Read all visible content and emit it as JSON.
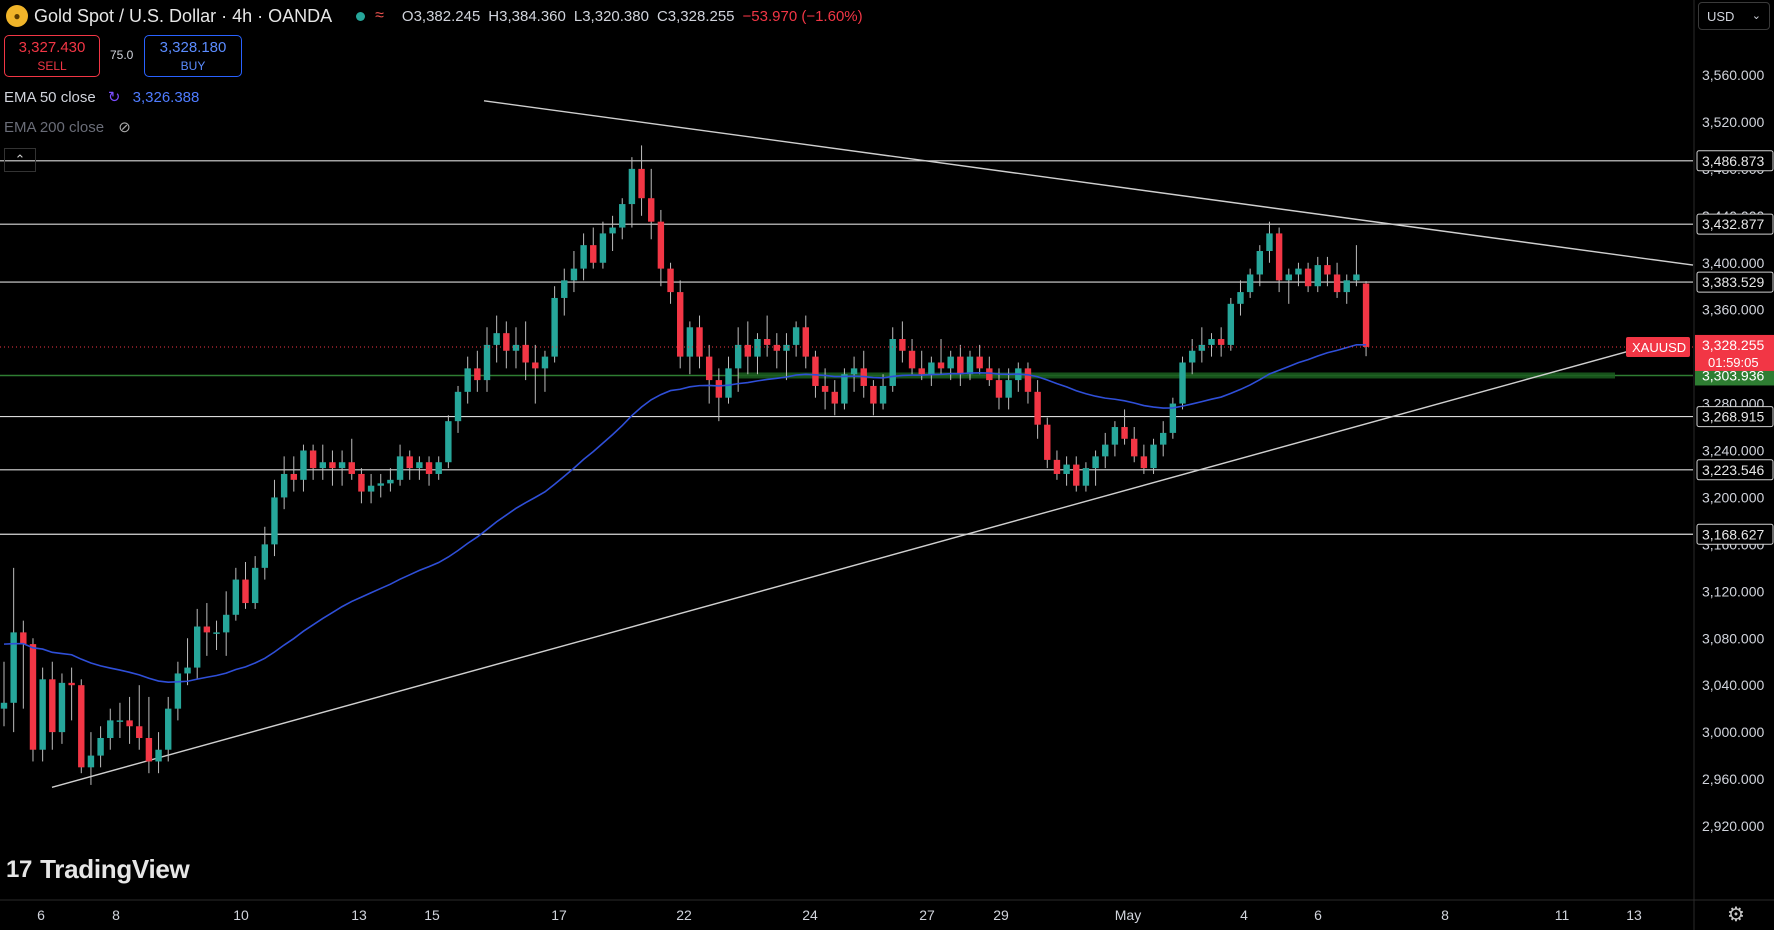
{
  "header": {
    "symbol": "Gold Spot / U.S. Dollar · 4h · OANDA",
    "open_label": "O",
    "open": "3,382.245",
    "high_label": "H",
    "high": "3,384.360",
    "low_label": "L",
    "low": "3,320.380",
    "close_label": "C",
    "close": "3,328.255",
    "change": "−53.970 (−1.60%)"
  },
  "trade": {
    "sell_price": "3,327.430",
    "sell_label": "SELL",
    "spread": "75.0",
    "buy_price": "3,328.180",
    "buy_label": "BUY"
  },
  "indicators": {
    "ema50_label": "EMA 50 close",
    "ema50_value": "3,326.388",
    "ema200_label": "EMA 200 close"
  },
  "currency": "USD",
  "brand": "TradingView",
  "colors": {
    "up": "#26a69a",
    "down": "#f23645",
    "ema": "#2f4fd8",
    "level": "#d9d9d9",
    "support": "#2e7d32",
    "background": "#000000"
  },
  "chart_data": {
    "type": "candlestick",
    "ylim": [
      2900,
      3600
    ],
    "y_ticks": [
      "3,560.000",
      "3,520.000",
      "3,480.000",
      "3,440.000",
      "3,400.000",
      "3,360.000",
      "3,320.000",
      "3,280.000",
      "3,240.000",
      "3,200.000",
      "3,160.000",
      "3,120.000",
      "3,080.000",
      "3,040.000",
      "3,000.000",
      "2,960.000",
      "2,920.000"
    ],
    "x_ticks": [
      "6",
      "8",
      "10",
      "13",
      "15",
      "17",
      "22",
      "24",
      "27",
      "29",
      "May",
      "4",
      "6",
      "8",
      "11",
      "13"
    ],
    "levels": [
      {
        "price": 3486.873,
        "label": "3,486.873"
      },
      {
        "price": 3432.877,
        "label": "3,432.877"
      },
      {
        "price": 3383.529,
        "label": "3,383.529"
      },
      {
        "price": 3268.915,
        "label": "3,268.915"
      },
      {
        "price": 3223.546,
        "label": "3,223.546"
      },
      {
        "price": 3168.627,
        "label": "3,168.627"
      }
    ],
    "support_zone": {
      "price": 3303.936,
      "label": "3,303.936"
    },
    "current": {
      "symbol": "XAUUSD",
      "price": 3328.255,
      "label": "3,328.255",
      "countdown": "01:59:05"
    },
    "ohlc": [
      [
        3020,
        3060,
        3005,
        3025
      ],
      [
        3025,
        3140,
        3000,
        3085
      ],
      [
        3085,
        3095,
        3020,
        3075
      ],
      [
        3075,
        3080,
        2975,
        2985
      ],
      [
        2985,
        3055,
        2975,
        3045
      ],
      [
        3045,
        3060,
        2985,
        3000
      ],
      [
        3000,
        3050,
        2990,
        3042
      ],
      [
        3042,
        3055,
        3010,
        3040
      ],
      [
        3040,
        3045,
        2965,
        2970
      ],
      [
        2970,
        3000,
        2955,
        2980
      ],
      [
        2980,
        3005,
        2970,
        2995
      ],
      [
        2995,
        3020,
        2985,
        3010
      ],
      [
        3010,
        3025,
        2995,
        3010
      ],
      [
        3010,
        3030,
        2990,
        3005
      ],
      [
        3005,
        3040,
        2985,
        2995
      ],
      [
        2995,
        3030,
        2965,
        2975
      ],
      [
        2975,
        3000,
        2965,
        2985
      ],
      [
        2985,
        3030,
        2975,
        3020
      ],
      [
        3020,
        3060,
        3010,
        3050
      ],
      [
        3050,
        3080,
        3040,
        3055
      ],
      [
        3055,
        3105,
        3045,
        3090
      ],
      [
        3090,
        3110,
        3065,
        3085
      ],
      [
        3085,
        3095,
        3070,
        3085
      ],
      [
        3085,
        3120,
        3065,
        3100
      ],
      [
        3100,
        3140,
        3095,
        3130
      ],
      [
        3130,
        3145,
        3105,
        3110
      ],
      [
        3110,
        3150,
        3105,
        3140
      ],
      [
        3140,
        3175,
        3130,
        3160
      ],
      [
        3160,
        3215,
        3150,
        3200
      ],
      [
        3200,
        3235,
        3190,
        3220
      ],
      [
        3220,
        3235,
        3205,
        3215
      ],
      [
        3215,
        3245,
        3205,
        3240
      ],
      [
        3240,
        3245,
        3215,
        3225
      ],
      [
        3225,
        3245,
        3215,
        3230
      ],
      [
        3230,
        3240,
        3210,
        3225
      ],
      [
        3225,
        3240,
        3210,
        3230
      ],
      [
        3230,
        3250,
        3215,
        3220
      ],
      [
        3220,
        3225,
        3195,
        3205
      ],
      [
        3205,
        3220,
        3195,
        3210
      ],
      [
        3210,
        3220,
        3200,
        3212
      ],
      [
        3212,
        3225,
        3205,
        3215
      ],
      [
        3215,
        3245,
        3210,
        3235
      ],
      [
        3235,
        3240,
        3215,
        3225
      ],
      [
        3225,
        3235,
        3215,
        3230
      ],
      [
        3230,
        3235,
        3210,
        3220
      ],
      [
        3220,
        3235,
        3215,
        3230
      ],
      [
        3230,
        3270,
        3225,
        3265
      ],
      [
        3265,
        3295,
        3255,
        3290
      ],
      [
        3290,
        3320,
        3280,
        3310
      ],
      [
        3310,
        3325,
        3290,
        3300
      ],
      [
        3300,
        3345,
        3290,
        3330
      ],
      [
        3330,
        3355,
        3315,
        3340
      ],
      [
        3340,
        3350,
        3310,
        3325
      ],
      [
        3325,
        3345,
        3310,
        3330
      ],
      [
        3330,
        3350,
        3300,
        3315
      ],
      [
        3315,
        3330,
        3280,
        3310
      ],
      [
        3310,
        3325,
        3290,
        3320
      ],
      [
        3320,
        3380,
        3315,
        3370
      ],
      [
        3370,
        3395,
        3355,
        3385
      ],
      [
        3385,
        3410,
        3375,
        3395
      ],
      [
        3395,
        3425,
        3385,
        3415
      ],
      [
        3415,
        3430,
        3395,
        3400
      ],
      [
        3400,
        3435,
        3395,
        3425
      ],
      [
        3425,
        3440,
        3410,
        3430
      ],
      [
        3430,
        3455,
        3420,
        3450
      ],
      [
        3450,
        3490,
        3430,
        3480
      ],
      [
        3480,
        3500,
        3440,
        3455
      ],
      [
        3455,
        3480,
        3420,
        3435
      ],
      [
        3435,
        3445,
        3380,
        3395
      ],
      [
        3395,
        3400,
        3365,
        3375
      ],
      [
        3375,
        3385,
        3310,
        3320
      ],
      [
        3320,
        3350,
        3305,
        3345
      ],
      [
        3345,
        3355,
        3310,
        3320
      ],
      [
        3320,
        3330,
        3280,
        3300
      ],
      [
        3300,
        3310,
        3265,
        3285
      ],
      [
        3285,
        3320,
        3280,
        3310
      ],
      [
        3310,
        3345,
        3290,
        3330
      ],
      [
        3330,
        3350,
        3305,
        3320
      ],
      [
        3320,
        3340,
        3305,
        3335
      ],
      [
        3335,
        3355,
        3320,
        3330
      ],
      [
        3330,
        3340,
        3310,
        3325
      ],
      [
        3325,
        3340,
        3300,
        3330
      ],
      [
        3330,
        3350,
        3320,
        3345
      ],
      [
        3345,
        3355,
        3310,
        3320
      ],
      [
        3320,
        3325,
        3285,
        3295
      ],
      [
        3295,
        3310,
        3275,
        3290
      ],
      [
        3290,
        3300,
        3270,
        3280
      ],
      [
        3280,
        3310,
        3275,
        3305
      ],
      [
        3305,
        3320,
        3290,
        3310
      ],
      [
        3310,
        3325,
        3285,
        3295
      ],
      [
        3295,
        3300,
        3270,
        3280
      ],
      [
        3280,
        3305,
        3275,
        3295
      ],
      [
        3295,
        3345,
        3290,
        3335
      ],
      [
        3335,
        3350,
        3315,
        3325
      ],
      [
        3325,
        3335,
        3305,
        3310
      ],
      [
        3310,
        3325,
        3300,
        3305
      ],
      [
        3305,
        3320,
        3295,
        3315
      ],
      [
        3315,
        3335,
        3305,
        3310
      ],
      [
        3310,
        3325,
        3300,
        3320
      ],
      [
        3320,
        3330,
        3295,
        3305
      ],
      [
        3305,
        3325,
        3300,
        3320
      ],
      [
        3320,
        3330,
        3305,
        3310
      ],
      [
        3310,
        3320,
        3295,
        3300
      ],
      [
        3300,
        3310,
        3275,
        3285
      ],
      [
        3285,
        3310,
        3275,
        3300
      ],
      [
        3300,
        3315,
        3290,
        3310
      ],
      [
        3310,
        3315,
        3280,
        3290
      ],
      [
        3290,
        3300,
        3250,
        3262
      ],
      [
        3262,
        3268,
        3225,
        3232
      ],
      [
        3232,
        3240,
        3215,
        3220
      ],
      [
        3220,
        3235,
        3210,
        3228
      ],
      [
        3228,
        3235,
        3205,
        3210
      ],
      [
        3210,
        3230,
        3205,
        3225
      ],
      [
        3225,
        3240,
        3210,
        3235
      ],
      [
        3235,
        3255,
        3225,
        3245
      ],
      [
        3245,
        3265,
        3235,
        3260
      ],
      [
        3260,
        3275,
        3245,
        3250
      ],
      [
        3250,
        3260,
        3230,
        3235
      ],
      [
        3235,
        3245,
        3220,
        3225
      ],
      [
        3225,
        3250,
        3220,
        3245
      ],
      [
        3245,
        3265,
        3235,
        3255
      ],
      [
        3255,
        3285,
        3250,
        3280
      ],
      [
        3280,
        3320,
        3275,
        3315
      ],
      [
        3315,
        3335,
        3305,
        3325
      ],
      [
        3325,
        3345,
        3315,
        3330
      ],
      [
        3330,
        3340,
        3320,
        3335
      ],
      [
        3335,
        3345,
        3320,
        3330
      ],
      [
        3330,
        3370,
        3325,
        3365
      ],
      [
        3365,
        3385,
        3355,
        3375
      ],
      [
        3375,
        3395,
        3370,
        3390
      ],
      [
        3390,
        3415,
        3380,
        3410
      ],
      [
        3410,
        3435,
        3400,
        3425
      ],
      [
        3425,
        3430,
        3375,
        3385
      ],
      [
        3385,
        3395,
        3365,
        3390
      ],
      [
        3390,
        3400,
        3380,
        3395
      ],
      [
        3395,
        3400,
        3375,
        3380
      ],
      [
        3380,
        3405,
        3375,
        3398
      ],
      [
        3398,
        3405,
        3380,
        3390
      ],
      [
        3390,
        3400,
        3370,
        3375
      ],
      [
        3375,
        3390,
        3365,
        3385
      ],
      [
        3385,
        3415,
        3380,
        3390
      ],
      [
        3382.245,
        3384.36,
        3320.38,
        3328.255
      ]
    ],
    "ema50_start": 3075
  }
}
